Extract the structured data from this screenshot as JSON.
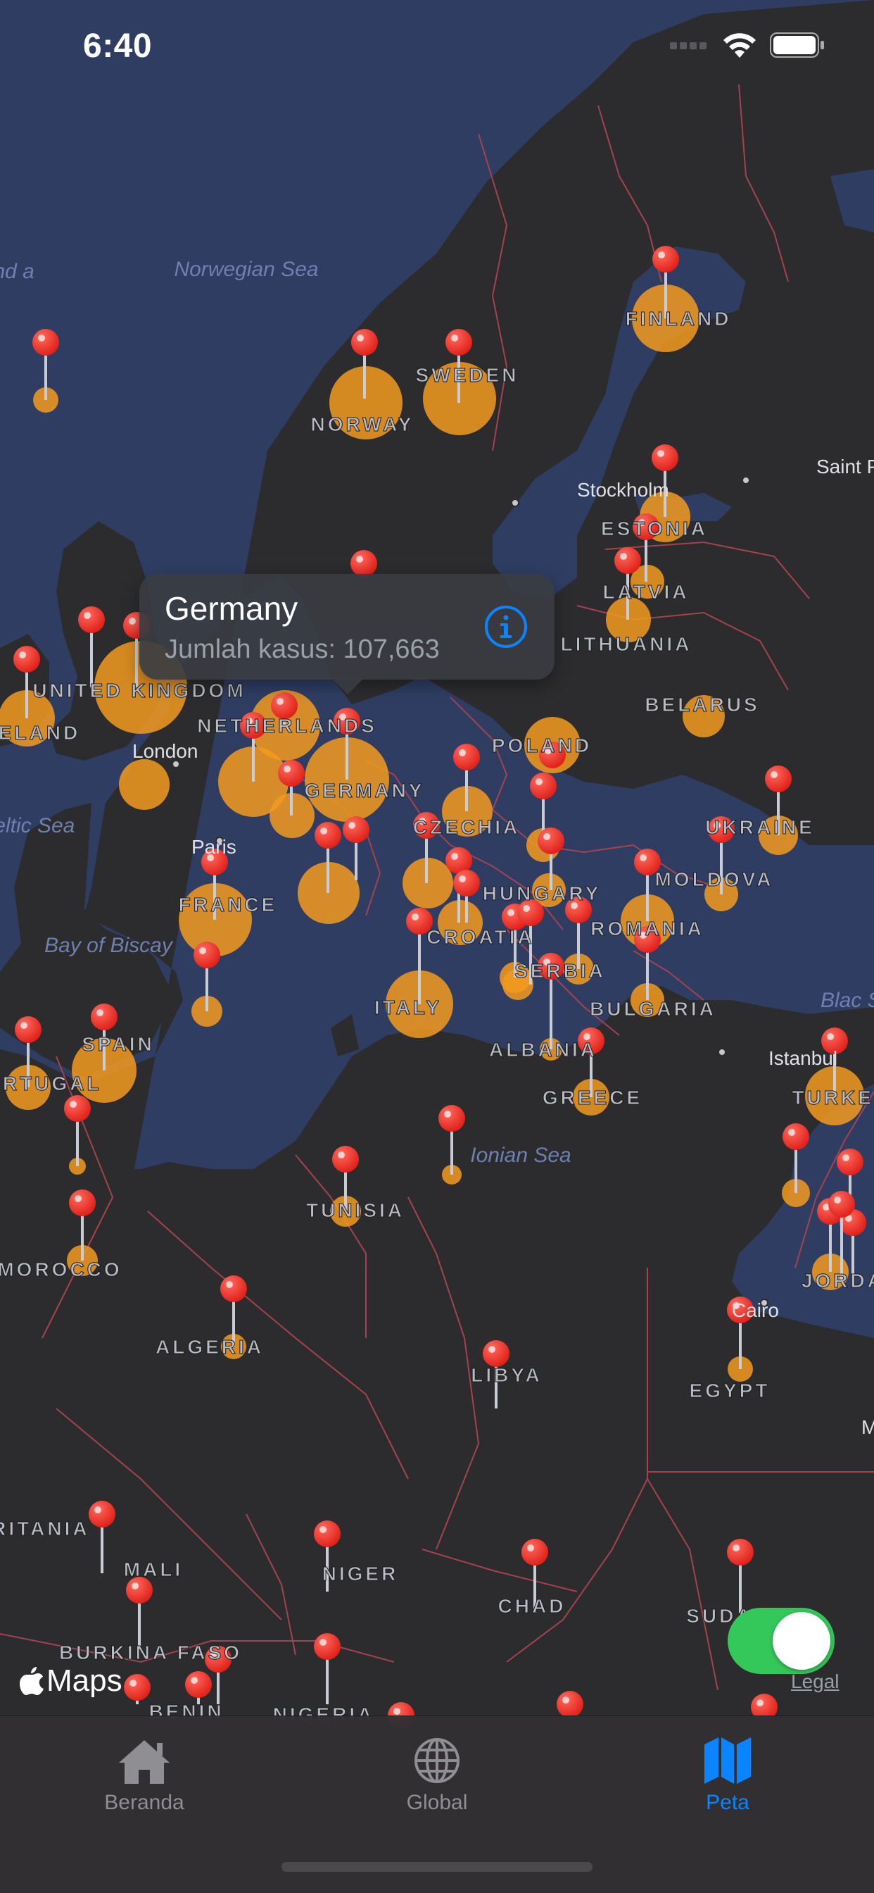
{
  "status_bar": {
    "time": "6:40"
  },
  "map": {
    "sea_labels": [
      "Norwegian Sea",
      "Celtic Sea",
      "Bay of Biscay",
      "Ionian Sea",
      "Blac Sea",
      "land a"
    ],
    "country_labels": [
      "FINLAND",
      "SWEDEN",
      "NORWAY",
      "ESTONIA",
      "LATVIA",
      "LITHUANIA",
      "BELARUS",
      "UNITED KINGDOM",
      "IRELAND",
      "NETHERLANDS",
      "GERMANY",
      "POLAND",
      "CZECHIA",
      "UKRAINE",
      "MOLDOVA",
      "HUNGARY",
      "ROMANIA",
      "FRANCE",
      "CROATIA",
      "SERBIA",
      "BULGARIA",
      "ITALY",
      "ALBANIA",
      "GREECE",
      "TURKEY",
      "SPAIN",
      "PORTUGAL",
      "MOROCCO",
      "ALGERIA",
      "TUNISIA",
      "LIBYA",
      "EGYPT",
      "JORDAN",
      "MALI",
      "NIGER",
      "CHAD",
      "SUDAN",
      "BURKINA FASO",
      "BENIN",
      "NIGERIA",
      "MAURITANIA"
    ],
    "city_labels": [
      "Stockholm",
      "Saint Peters",
      "London",
      "Paris",
      "Istanbul",
      "Cairo",
      "Me"
    ],
    "brand": "Maps",
    "legal": "Legal"
  },
  "callout": {
    "title": "Germany",
    "subtitle": "Jumlah kasus: 107,663",
    "info_icon": "info-circle-icon"
  },
  "toggle": {
    "state": "on",
    "color": "#34c759"
  },
  "tabs": [
    {
      "label": "Beranda",
      "icon": "house-icon",
      "active": false
    },
    {
      "label": "Global",
      "icon": "globe-icon",
      "active": false
    },
    {
      "label": "Peta",
      "icon": "map-icon",
      "active": true
    }
  ],
  "colors": {
    "accent": "#0a84ff",
    "pin": "#ff3b30",
    "bubble": "#f39a1e",
    "border": "#a2434f"
  }
}
